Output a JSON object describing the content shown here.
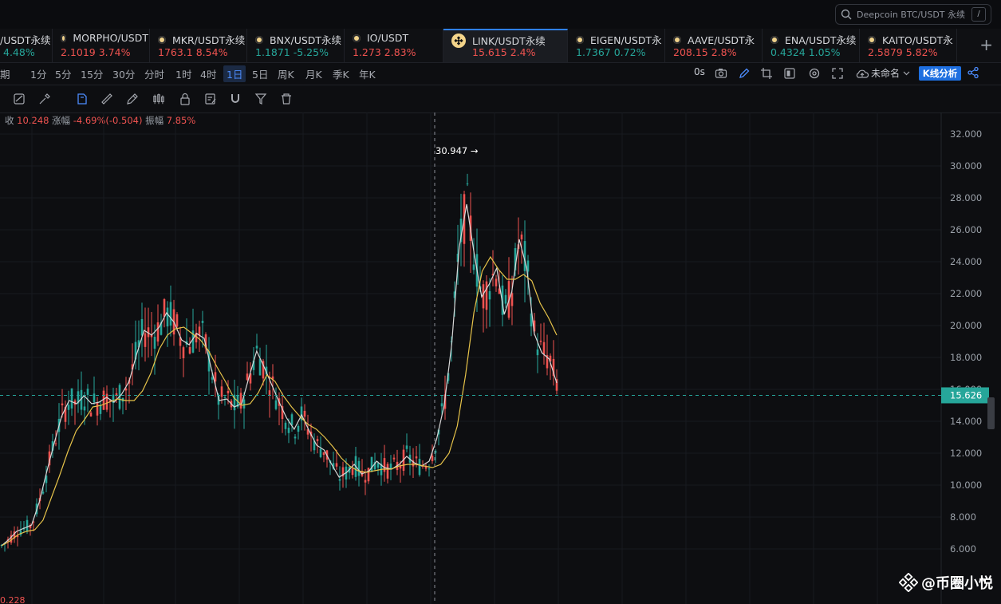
{
  "search": {
    "placeholder": "Deepcoin BTC/USDT 永续",
    "shortcut": "/"
  },
  "tickers": [
    {
      "name": "/USDT永续",
      "price": "",
      "change": "4.48%",
      "dir": "up",
      "active": false
    },
    {
      "name": "MORPHO/USDT",
      "price": "2.1019",
      "change": "3.74%",
      "dir": "down",
      "active": false
    },
    {
      "name": "MKR/USDT永续",
      "price": "1763.1",
      "change": "8.54%",
      "dir": "down",
      "active": false
    },
    {
      "name": "BNX/USDT永续",
      "price": "1.1871",
      "change": "-5.25%",
      "dir": "up",
      "active": false
    },
    {
      "name": "IO/USDT",
      "price": "1.273",
      "change": "2.83%",
      "dir": "down",
      "active": false
    },
    {
      "name": "LINK/USDT永续",
      "price": "15.615",
      "change": "2.4%",
      "dir": "down",
      "active": true
    },
    {
      "name": "EIGEN/USDT永",
      "price": "1.7367",
      "change": "0.72%",
      "dir": "up",
      "active": false
    },
    {
      "name": "AAVE/USDT永",
      "price": "208.15",
      "change": "2.8%",
      "dir": "down",
      "active": false
    },
    {
      "name": "ENA/USDT永续",
      "price": "0.4324",
      "change": "1.05%",
      "dir": "up",
      "active": false
    },
    {
      "name": "KAITO/USDT永",
      "price": "2.5879",
      "change": "5.82%",
      "dir": "down",
      "active": false
    }
  ],
  "timeframes": [
    "期",
    "1分",
    "5分",
    "15分",
    "30分",
    "分时",
    "1时",
    "4时",
    "1日",
    "5日",
    "周K",
    "月K",
    "季K",
    "年K"
  ],
  "selected_timeframe": "1日",
  "right_tools": {
    "countdown": "0s",
    "layout_name": "未命名",
    "kline_button": "K线分析"
  },
  "info_bar": {
    "close_label": "收",
    "close_value": "10.248",
    "change_label": "涨幅",
    "change_value": "-4.69%(-0.504)",
    "amp_label": "振幅",
    "amp_value": "7.85%"
  },
  "colors": {
    "up": "#26a69a",
    "down": "#ef5350",
    "ma1": "#d8d8d8",
    "ma2": "#e6c34a",
    "accent": "#2f80ed",
    "last_price_bg": "#26a69a"
  },
  "chart_data": {
    "type": "candlestick",
    "y_axis_ticks": [
      "32.000",
      "30.000",
      "28.000",
      "26.000",
      "24.000",
      "22.000",
      "20.000",
      "18.000",
      "16.000",
      "14.000",
      "12.000",
      "10.000",
      "8.000",
      "6.000"
    ],
    "ylim": [
      5.0,
      33.0
    ],
    "last_price": "15.626",
    "high_marker": "30.947",
    "bottom_partial_label": "0.228",
    "ma_short": [
      6.2,
      6.6,
      7.1,
      7.3,
      7.5,
      8.9,
      10.8,
      12.6,
      14.3,
      15.3,
      15.1,
      15.6,
      15.1,
      15.2,
      15.5,
      15.2,
      15.7,
      16.5,
      18.2,
      19.7,
      19.4,
      19.9,
      20.8,
      20.2,
      19.1,
      18.8,
      19.5,
      19.2,
      17.2,
      15.3,
      15.4,
      14.9,
      15.1,
      16.8,
      18.4,
      17.4,
      16.3,
      15.2,
      14.2,
      13.5,
      14.4,
      13.4,
      12.5,
      12.2,
      11.3,
      10.5,
      10.8,
      11.3,
      10.7,
      10.9,
      11.5,
      11.1,
      11.0,
      11.3,
      11.8,
      11.4,
      11.2,
      11.5,
      12.9,
      15.0,
      18.8,
      24.9,
      27.6,
      24.5,
      21.8,
      22.6,
      23.6,
      20.7,
      22.1,
      25.4,
      23.6,
      19.5,
      18.3,
      17.9,
      16.4
    ],
    "ma_long": [
      6.2,
      6.5,
      6.9,
      7.1,
      7.2,
      7.8,
      9.2,
      10.6,
      12.1,
      13.4,
      14.1,
      14.9,
      15.0,
      15.2,
      15.4,
      15.3,
      15.3,
      15.9,
      17.0,
      18.5,
      19.4,
      19.8,
      19.9,
      19.5,
      19.1,
      18.4,
      17.4,
      16.5,
      15.5,
      15.0,
      15.1,
      15.8,
      16.9,
      16.5,
      15.6,
      14.9,
      14.3,
      13.8,
      13.5,
      13.0,
      12.4,
      11.7,
      11.2,
      10.9,
      10.8,
      10.9,
      11.0,
      11.0,
      11.2,
      11.3,
      11.3,
      11.2,
      11.1,
      11.3,
      12.0,
      13.7,
      16.9,
      20.8,
      23.4,
      24.3,
      23.5,
      22.9,
      22.9,
      23.2,
      22.8,
      21.4,
      20.5,
      19.4
    ],
    "high_low_range": {
      "high": 30.947,
      "low": 7.9
    }
  },
  "watermark": "@币圈小悦"
}
